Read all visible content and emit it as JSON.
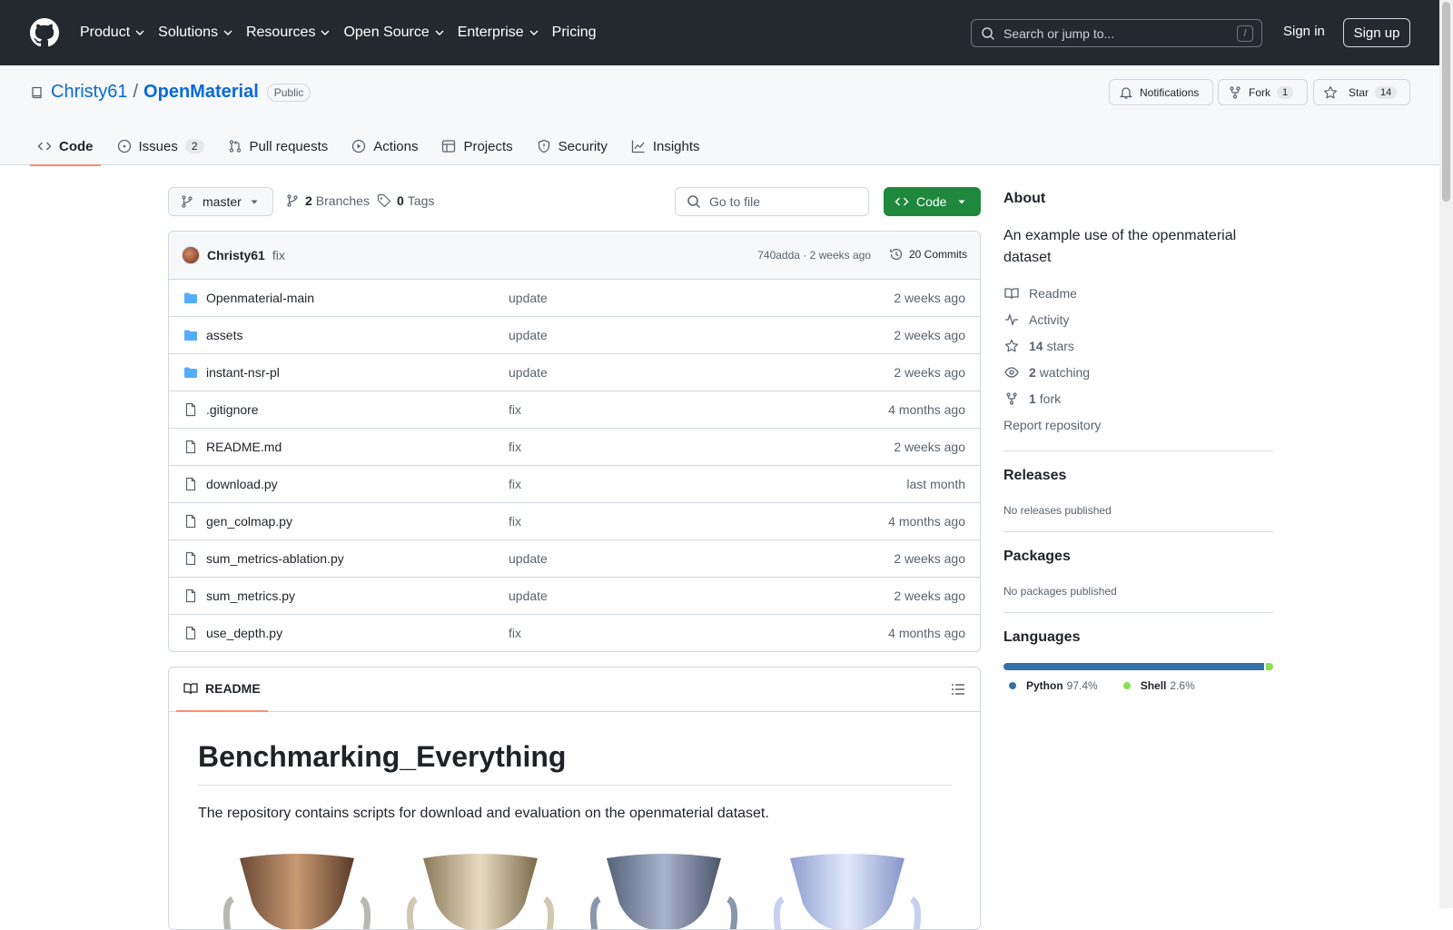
{
  "header": {
    "nav": [
      {
        "label": "Product"
      },
      {
        "label": "Solutions"
      },
      {
        "label": "Resources"
      },
      {
        "label": "Open Source"
      },
      {
        "label": "Enterprise"
      },
      {
        "label": "Pricing"
      }
    ],
    "search_placeholder": "Search or jump to...",
    "search_key": "/",
    "signin": "Sign in",
    "signup": "Sign up"
  },
  "repo": {
    "owner": "Christy61",
    "separator": "/",
    "name": "OpenMaterial",
    "visibility": "Public",
    "notifications_label": "Notifications",
    "fork_label": "Fork",
    "fork_count": "1",
    "star_label": "Star",
    "star_count": "14"
  },
  "tabs": [
    {
      "label": "Code",
      "icon": "code-icon"
    },
    {
      "label": "Issues",
      "icon": "issue-icon",
      "count": "2"
    },
    {
      "label": "Pull requests",
      "icon": "pull-request-icon"
    },
    {
      "label": "Actions",
      "icon": "play-icon"
    },
    {
      "label": "Projects",
      "icon": "table-icon"
    },
    {
      "label": "Security",
      "icon": "shield-icon"
    },
    {
      "label": "Insights",
      "icon": "graph-icon"
    }
  ],
  "toolbar": {
    "branch": "master",
    "branches_count": "2",
    "branches_label": "Branches",
    "tags_count": "0",
    "tags_label": "Tags",
    "goto_placeholder": "Go to file",
    "code_label": "Code"
  },
  "commit": {
    "author": "Christy61",
    "message": "fix",
    "meta": "740adda · 2 weeks ago",
    "count_label": "20 Commits"
  },
  "files": [
    {
      "name": "Openmaterial-main",
      "type": "folder",
      "message": "update",
      "time": "2 weeks ago"
    },
    {
      "name": "assets",
      "type": "folder",
      "message": "update",
      "time": "2 weeks ago"
    },
    {
      "name": "instant-nsr-pl",
      "type": "folder",
      "message": "update",
      "time": "2 weeks ago"
    },
    {
      "name": ".gitignore",
      "type": "file",
      "message": "fix",
      "time": "4 months ago"
    },
    {
      "name": "README.md",
      "type": "file",
      "message": "fix",
      "time": "2 weeks ago"
    },
    {
      "name": "download.py",
      "type": "file",
      "message": "fix",
      "time": "last month"
    },
    {
      "name": "gen_colmap.py",
      "type": "file",
      "message": "fix",
      "time": "4 months ago"
    },
    {
      "name": "sum_metrics-ablation.py",
      "type": "file",
      "message": "update",
      "time": "2 weeks ago"
    },
    {
      "name": "sum_metrics.py",
      "type": "file",
      "message": "update",
      "time": "2 weeks ago"
    },
    {
      "name": "use_depth.py",
      "type": "file",
      "message": "fix",
      "time": "4 months ago"
    }
  ],
  "readme": {
    "tab_label": "README",
    "title": "Benchmarking_Everything",
    "paragraph": "The repository contains scripts for download and evaluation on the openmaterial dataset."
  },
  "about": {
    "heading": "About",
    "description": "An example use of the openmaterial dataset",
    "readme_label": "Readme",
    "activity_label": "Activity",
    "stars_count": "14",
    "stars_label": "stars",
    "watching_count": "2",
    "watching_label": "watching",
    "forks_count": "1",
    "forks_label": "fork",
    "report_label": "Report repository"
  },
  "releases": {
    "heading": "Releases",
    "empty": "No releases published"
  },
  "packages": {
    "heading": "Packages",
    "empty": "No packages published"
  },
  "languages": {
    "heading": "Languages",
    "items": [
      {
        "name": "Python",
        "percent": "97.4%",
        "value": 97.4,
        "color": "#3572A5"
      },
      {
        "name": "Shell",
        "percent": "2.6%",
        "value": 2.6,
        "color": "#89e051"
      }
    ]
  }
}
